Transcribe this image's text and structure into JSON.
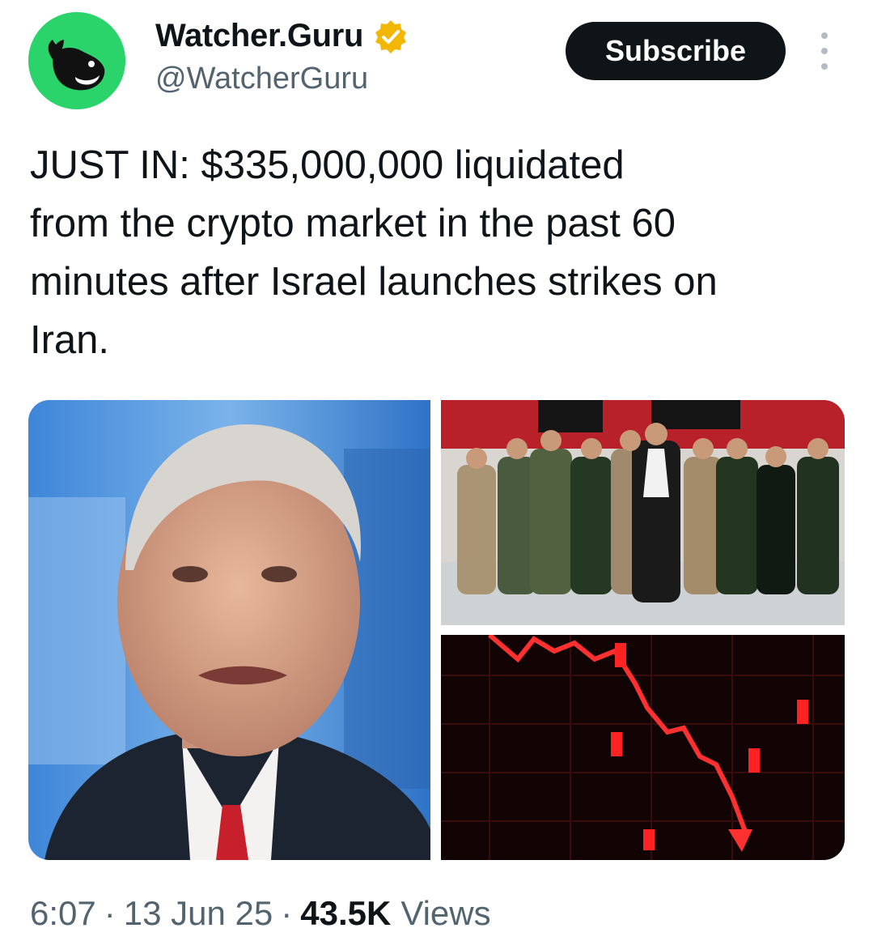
{
  "author": {
    "display_name": "Watcher.Guru",
    "handle": "@WatcherGuru",
    "avatar_icon": "whale-logo-icon",
    "verified_icon": "verified-badge-icon",
    "verified_color": "#f2b705",
    "avatar_bg": "#2bd46a"
  },
  "header": {
    "subscribe_label": "Subscribe",
    "more_icon": "more-options-icon"
  },
  "tweet": {
    "text": "JUST IN: $335,000,000 liquidated\nfrom the crypto market in the past 60\nminutes after Israel launches strikes on\nIran."
  },
  "media": {
    "items": [
      {
        "icon": "portrait-photo"
      },
      {
        "icon": "military-group-photo"
      },
      {
        "icon": "red-falling-chart-photo"
      }
    ]
  },
  "footer": {
    "time": "6:07",
    "separator": "·",
    "date": "13 Jun 25",
    "views_count": "43.5K",
    "views_label": "Views"
  }
}
